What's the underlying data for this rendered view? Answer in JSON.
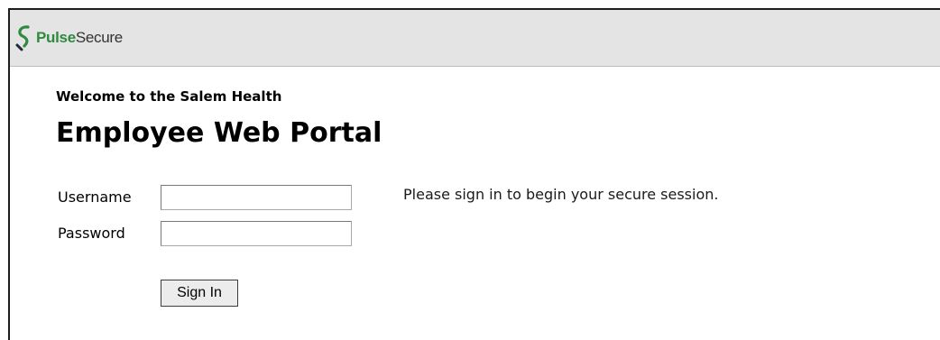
{
  "header": {
    "logo_icon": "pulse-secure-s-icon",
    "logo_brand": "Pulse",
    "logo_product": "Secure",
    "brand_color": "#2f8a3f"
  },
  "main": {
    "welcome_text": "Welcome to the Salem Health",
    "title": "Employee Web Portal",
    "notice": "Please sign in to begin your secure session."
  },
  "form": {
    "username_label": "Username",
    "username_value": "",
    "password_label": "Password",
    "password_value": "",
    "signin_label": "Sign In"
  }
}
